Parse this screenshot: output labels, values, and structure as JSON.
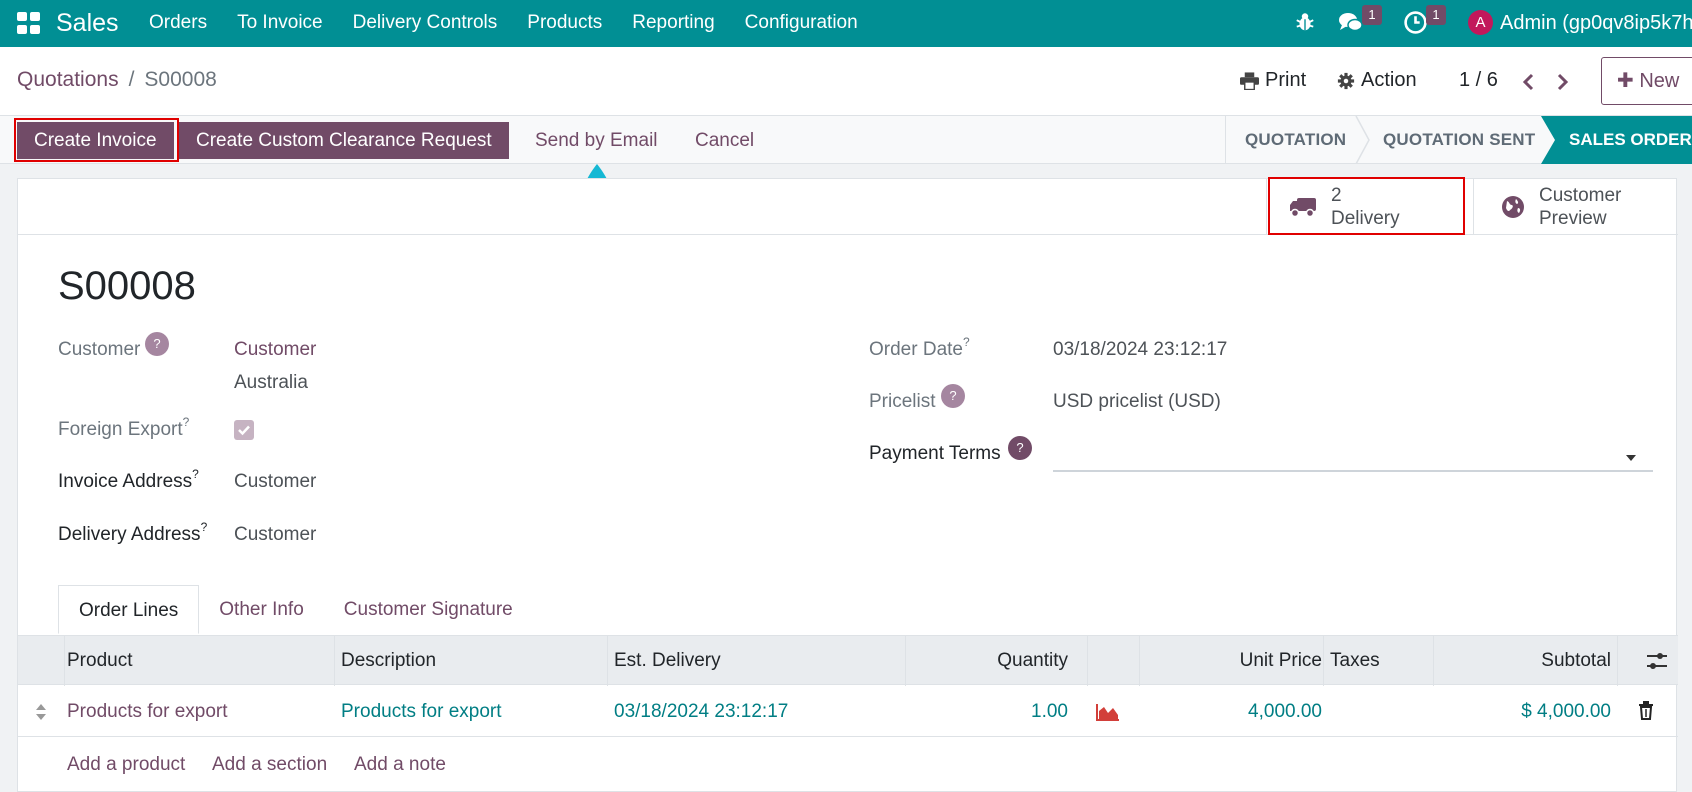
{
  "navbar": {
    "brand": "Sales",
    "menu": [
      "Orders",
      "To Invoice",
      "Delivery Controls",
      "Products",
      "Reporting",
      "Configuration"
    ],
    "chat_count": "1",
    "activity_count": "1",
    "avatar_letter": "A",
    "user": "Admin (gp0qv8ip5k7h",
    "color": "#018f94"
  },
  "breadcrumb": {
    "parent": "Quotations",
    "separator": "/",
    "current": "S00008"
  },
  "control": {
    "print": "Print",
    "action": "Action",
    "pager": "1 / 6",
    "new": "New"
  },
  "actions": {
    "create_invoice": "Create Invoice",
    "custom_clearance": "Create Custom Clearance Request",
    "send_email": "Send by Email",
    "cancel": "Cancel"
  },
  "status": {
    "steps": [
      "QUOTATION",
      "QUOTATION SENT",
      "SALES ORDER"
    ],
    "active": "SALES ORDER"
  },
  "smart_buttons": {
    "delivery_count": "2",
    "delivery_label": "Delivery",
    "preview_line1": "Customer",
    "preview_line2": "Preview"
  },
  "form": {
    "name": "S00008",
    "customer_label": "Customer",
    "customer_name": "Customer",
    "customer_country": "Australia",
    "foreign_export_label": "Foreign Export",
    "foreign_export_checked": true,
    "invoice_address_label": "Invoice Address",
    "invoice_address": "Customer",
    "delivery_address_label": "Delivery Address",
    "delivery_address": "Customer",
    "order_date_label": "Order Date",
    "order_date": "03/18/2024 23:12:17",
    "pricelist_label": "Pricelist",
    "pricelist": "USD pricelist (USD)",
    "payment_terms_label": "Payment Terms",
    "payment_terms": "",
    "help_mark": "?"
  },
  "tabs": [
    "Order Lines",
    "Other Info",
    "Customer Signature"
  ],
  "table": {
    "columns": [
      "Product",
      "Description",
      "Est. Delivery",
      "Quantity",
      "Unit Price",
      "Taxes",
      "Subtotal"
    ],
    "rows": [
      {
        "product": "Products for export",
        "description": "Products for export",
        "est_delivery": "03/18/2024 23:12:17",
        "quantity": "1.00",
        "unit_price": "4,000.00",
        "taxes": "",
        "subtotal": "$ 4,000.00"
      }
    ],
    "add_product": "Add a product",
    "add_section": "Add a section",
    "add_note": "Add a note"
  }
}
